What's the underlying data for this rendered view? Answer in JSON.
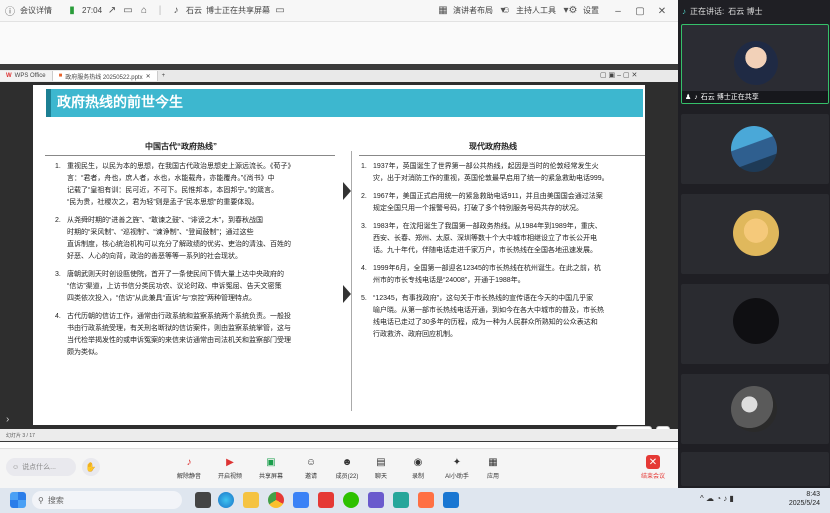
{
  "topbar": {
    "meeting_details": "会议详情",
    "timer": "27:04",
    "presenter_name": "石云",
    "sharing_status": "博士正在共享屏幕",
    "presenter_layout": "演讲者布局",
    "host_tools": "主持人工具",
    "settings": "设置"
  },
  "panel": {
    "speaking_label": "正在讲话:",
    "speaking_name": "石云 博士",
    "self_tile_label": "石云 博士正在共享"
  },
  "app": {
    "tabs": [
      "WPS Office",
      "政府服务热线 20250522.pptx"
    ],
    "status_text": "幻灯片 3 / 17"
  },
  "slide": {
    "title": "政府热线的前世今生",
    "left_heading": "中国古代“政府热线”",
    "right_heading": "现代政府热线",
    "left_items": [
      {
        "num": "1.",
        "lines": [
          "重视民生，以民为本的思想，在我国古代政治思想史上源远流长。《荀子》",
          "言：“君者，舟也，庶人者，水也，水能载舟，亦能覆舟。”《尚书》中",
          "记载了“皇祖有训：民可近，不可下。民惟邦本，本固邦宁。”的箴言。",
          "“民为贵，社稷次之，君为轻”则是孟子“民本思想”的重要体现。"
        ]
      },
      {
        "num": "2.",
        "lines": [
          "从尧舜时期的“进善之旌”、“敢谏之鼓”、“诽谤之木”，到春秋战国",
          "时期的“采风制”、“巡视制”、“谏诤制”、“登闻鼓制”；通过这些",
          "直诉制度，核心统治机构可以充分了解政绩的优劣、吏治的清浊、百姓的",
          "好恶、人心的向背，政治的善恶等等一系列的社会现状。"
        ]
      },
      {
        "num": "3.",
        "lines": [
          "唐朝武则天时创设匦使院，首开了一条使民间下情大量上达中央政府的",
          "“信访”渠道，上访书信分类民功农、议论时政、申诉冤屈、告天文密策",
          "四类依次投入，“信访”从此兼具“直诉”与“京控”两种管理特点。"
        ]
      },
      {
        "num": "4.",
        "lines": [
          "古代历朝的信访工作，通常由行政系统和监察系统两个系统负责。一般投",
          "书由行政系统受理，有关刑名断狱的信访案件，则由监察系统掌管，这与",
          "当代检举揭发性的或申诉冤案的来信来访通常由司法机关和监察部门受理",
          "颇为类似。"
        ]
      }
    ],
    "right_items": [
      {
        "num": "1.",
        "lines": [
          "1937年，英国诞生了世界第一部公共热线，起因是当时的伦敦经常发生火",
          "灾，出于对消防工作的重视，英国伦敦最早启用了统一的紧急救助电话999。"
        ]
      },
      {
        "num": "2.",
        "lines": [
          "1967年，美国正式启用统一的紧急救助电话911，并且由美国国会通过法案",
          "规定全国只用一个报警号码，打破了多个特别服务号码共存的状况。"
        ]
      },
      {
        "num": "3.",
        "lines": [
          "1983年，在沈阳诞生了我国第一部政务热线。从1984年到1989年，重庆、",
          "西安、长春、郑州、太原、深圳等数十个大中城市相继设立了市长公开电",
          "话。九十年代，伴随电话走进千家万户，市长热线在全国各地迅速发展。"
        ]
      },
      {
        "num": "4.",
        "lines": [
          "1999年6月，全国第一部迎名12345的市长热线在杭州诞生。在此之前，杭",
          "州市的市长专线电话是“24008”，开通于1988年。"
        ]
      },
      {
        "num": "5.",
        "lines": [
          "“12345，有事找政府”，这句关于市长热线的宣传语在今天的中国几乎家",
          "喻户晓。从第一部市长热线电话开通，到如今在各大中城市的普及，市长热",
          "线电话已走过了30多年的历程，成为一种为人民群众所熟知的公众表达和",
          "行政救济、政府回应机制。"
        ]
      }
    ]
  },
  "toolbar": {
    "chat_placeholder": "说点什么...",
    "buttons": [
      "解除静音",
      "开启视频",
      "共享屏幕",
      "邀请",
      "成员(22)",
      "聊天",
      "录制",
      "AI小助手",
      "应用"
    ],
    "end_meeting": "结束会议"
  },
  "taskbar": {
    "search_placeholder": "搜索",
    "time": "8:43",
    "date": "2025/5/24"
  }
}
